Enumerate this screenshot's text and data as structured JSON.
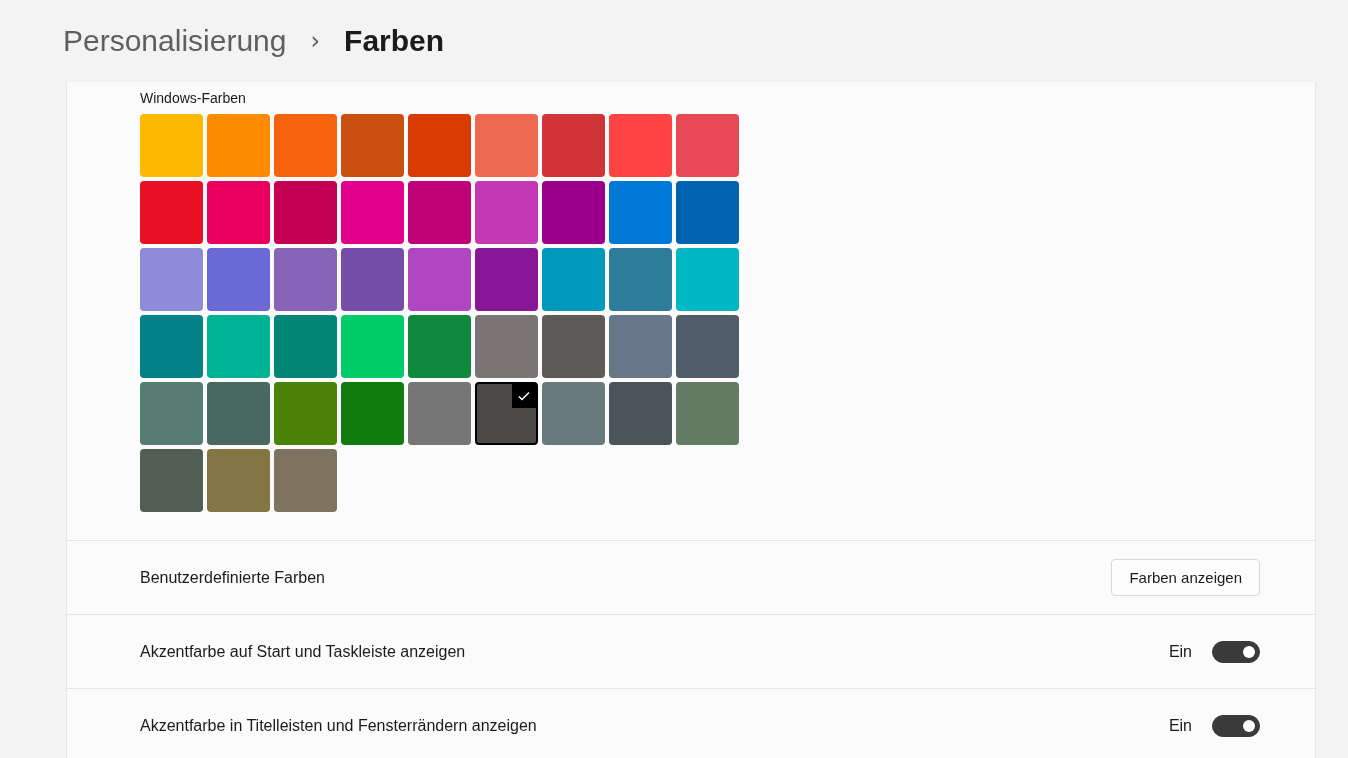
{
  "breadcrumb": {
    "parent": "Personalisierung",
    "separator": "›",
    "current": "Farben"
  },
  "palette": {
    "title": "Windows-Farben",
    "swatches": [
      {
        "color": "#ffb900",
        "selected": false
      },
      {
        "color": "#ff8c00",
        "selected": false
      },
      {
        "color": "#f7630c",
        "selected": false
      },
      {
        "color": "#ca5010",
        "selected": false
      },
      {
        "color": "#da3b01",
        "selected": false
      },
      {
        "color": "#ef6950",
        "selected": false
      },
      {
        "color": "#d13438",
        "selected": false
      },
      {
        "color": "#ff4343",
        "selected": false
      },
      {
        "color": "#e74856",
        "selected": false
      },
      {
        "color": "#e81123",
        "selected": false
      },
      {
        "color": "#ea005e",
        "selected": false
      },
      {
        "color": "#c30052",
        "selected": false
      },
      {
        "color": "#e3008c",
        "selected": false
      },
      {
        "color": "#bf0077",
        "selected": false
      },
      {
        "color": "#c239b3",
        "selected": false
      },
      {
        "color": "#9a0089",
        "selected": false
      },
      {
        "color": "#0078d7",
        "selected": false
      },
      {
        "color": "#0063b1",
        "selected": false
      },
      {
        "color": "#8e8cd8",
        "selected": false
      },
      {
        "color": "#6b69d6",
        "selected": false
      },
      {
        "color": "#8764b8",
        "selected": false
      },
      {
        "color": "#744da9",
        "selected": false
      },
      {
        "color": "#b146c2",
        "selected": false
      },
      {
        "color": "#881798",
        "selected": false
      },
      {
        "color": "#0099bc",
        "selected": false
      },
      {
        "color": "#2d7d9a",
        "selected": false
      },
      {
        "color": "#00b7c3",
        "selected": false
      },
      {
        "color": "#038387",
        "selected": false
      },
      {
        "color": "#00b294",
        "selected": false
      },
      {
        "color": "#018574",
        "selected": false
      },
      {
        "color": "#00cc6a",
        "selected": false
      },
      {
        "color": "#10893e",
        "selected": false
      },
      {
        "color": "#7a7574",
        "selected": false
      },
      {
        "color": "#5d5a58",
        "selected": false
      },
      {
        "color": "#68768a",
        "selected": false
      },
      {
        "color": "#515c6b",
        "selected": false
      },
      {
        "color": "#567c73",
        "selected": false
      },
      {
        "color": "#486860",
        "selected": false
      },
      {
        "color": "#498205",
        "selected": false
      },
      {
        "color": "#107c10",
        "selected": false
      },
      {
        "color": "#767676",
        "selected": false
      },
      {
        "color": "#4c4a48",
        "selected": true
      },
      {
        "color": "#69797e",
        "selected": false
      },
      {
        "color": "#4a5459",
        "selected": false
      },
      {
        "color": "#647c64",
        "selected": false
      },
      {
        "color": "#525e54",
        "selected": false
      },
      {
        "color": "#847545",
        "selected": false
      },
      {
        "color": "#7e735f",
        "selected": false
      }
    ]
  },
  "rows": [
    {
      "kind": "button",
      "label": "Benutzerdefinierte Farben",
      "button": "Farben anzeigen"
    },
    {
      "kind": "toggle",
      "label": "Akzentfarbe auf Start und Taskleiste anzeigen",
      "state_text": "Ein",
      "on": true
    },
    {
      "kind": "toggle",
      "label": "Akzentfarbe in Titelleisten und Fensterrändern anzeigen",
      "state_text": "Ein",
      "on": true
    }
  ]
}
